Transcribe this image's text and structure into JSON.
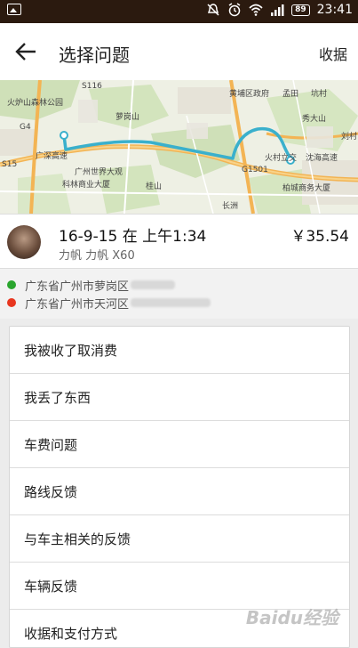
{
  "status_bar": {
    "battery": "89",
    "time": "23:41"
  },
  "app_bar": {
    "title": "选择问题",
    "receipt_label": "收据"
  },
  "map": {
    "labels": [
      "火炉山森林公园",
      "S116",
      "萝岗山",
      "黄埔区政府",
      "孟田",
      "坑村",
      "秀大山",
      "G4",
      "广深高速",
      "广州世界大观",
      "科林商业大厦",
      "G1501",
      "桂山",
      "火村立交",
      "沈海高速",
      "柏城商务大厦",
      "刘村",
      "长洲",
      "S15"
    ]
  },
  "trip": {
    "datetime": "16-9-15 在 上午1:34",
    "car": "力帆 力帆 X60",
    "fare": "￥35.54"
  },
  "route": {
    "pickup": "广东省广州市萝岗区",
    "dropoff": "广东省广州市天河区",
    "pickup_color": "#2aa52e",
    "dropoff_color": "#e8361f"
  },
  "problems": [
    "我被收了取消费",
    "我丢了东西",
    "车费问题",
    "路线反馈",
    "与车主相关的反馈",
    "车辆反馈",
    "收据和支付方式"
  ],
  "watermark": "Baidu经验"
}
